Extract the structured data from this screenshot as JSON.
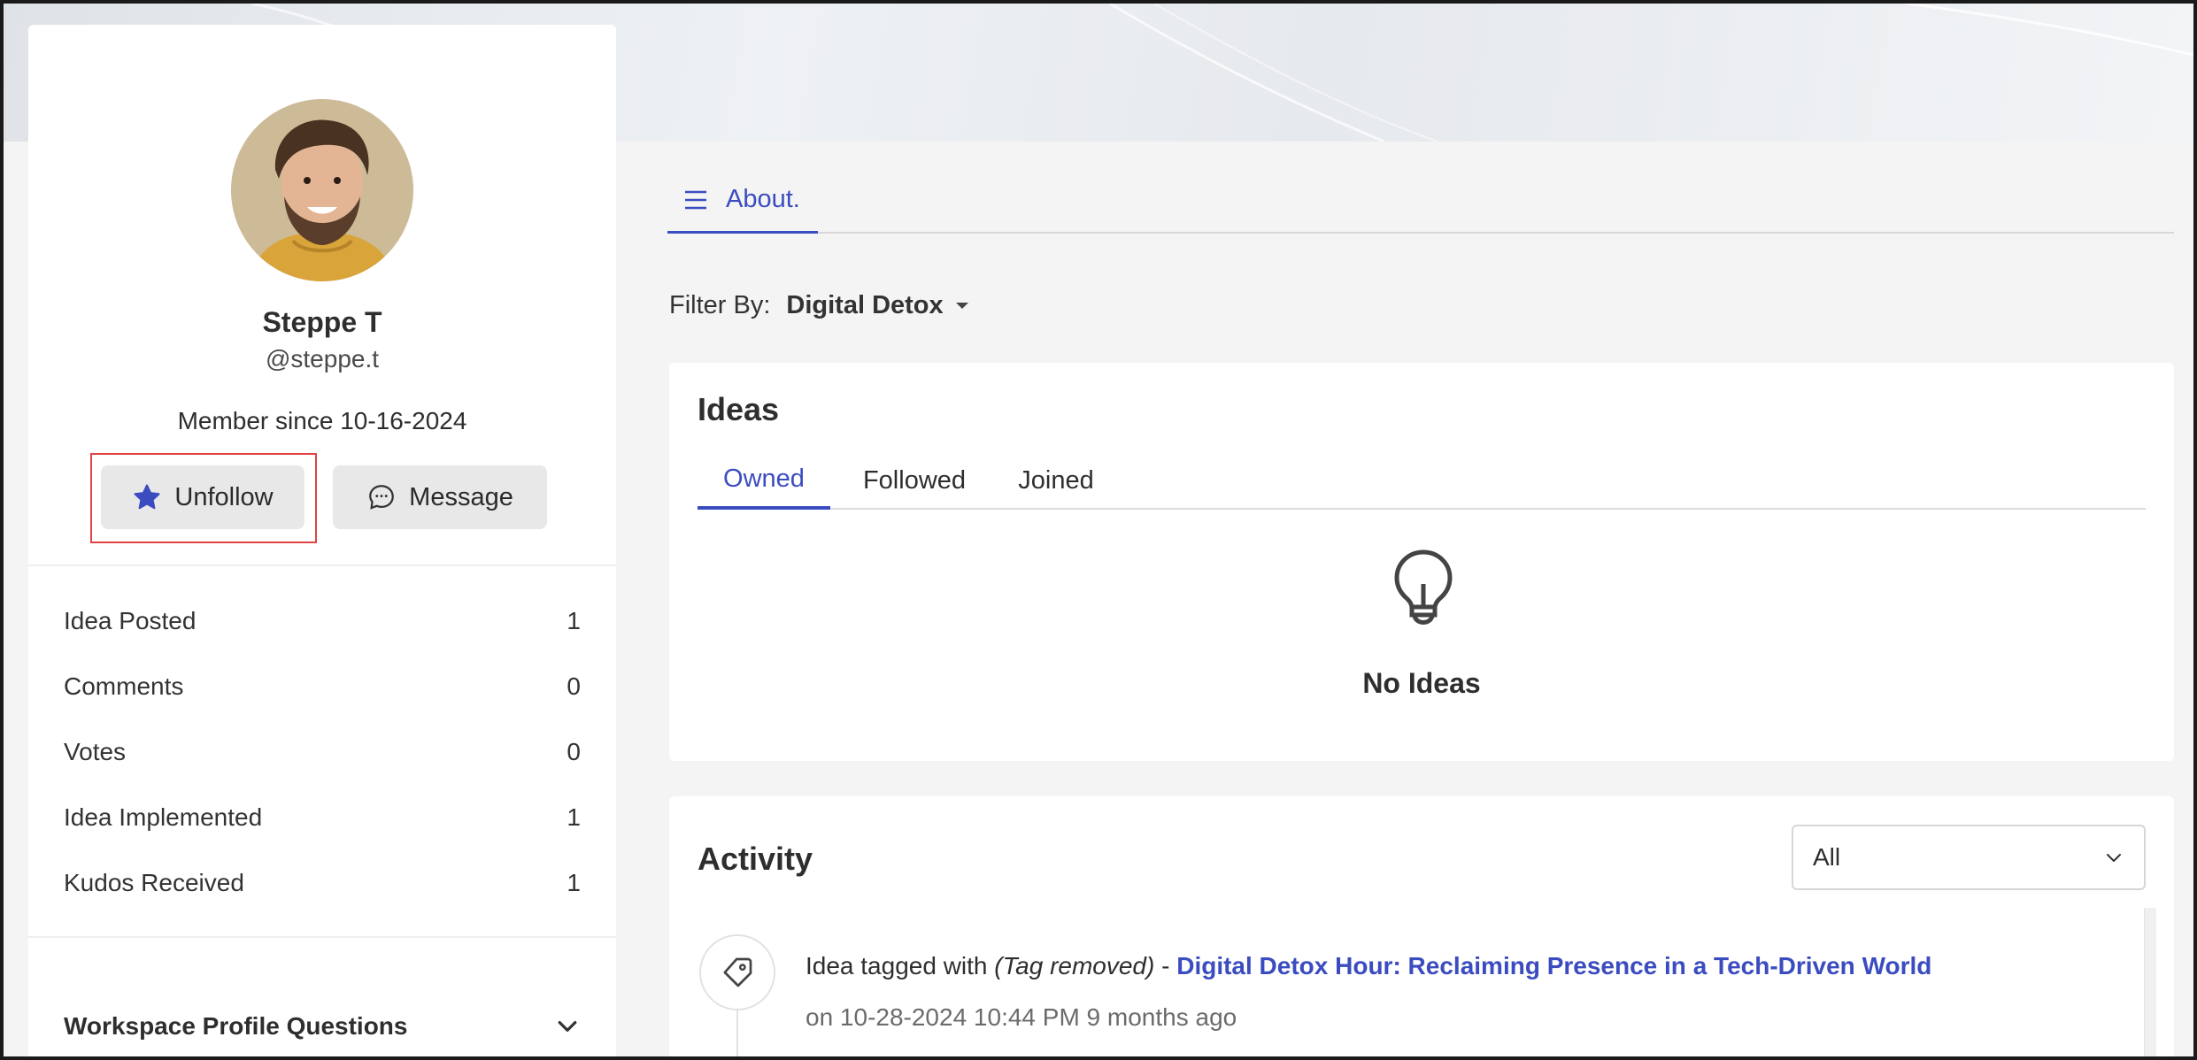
{
  "profile": {
    "name": "Steppe T",
    "handle": "@steppe.t",
    "member_since_label": "Member since",
    "member_since_date": "10-16-2024",
    "unfollow_label": "Unfollow",
    "message_label": "Message",
    "stats": [
      {
        "label": "Idea Posted",
        "value": "1"
      },
      {
        "label": "Comments",
        "value": "0"
      },
      {
        "label": "Votes",
        "value": "0"
      },
      {
        "label": "Idea Implemented",
        "value": "1"
      },
      {
        "label": "Kudos Received",
        "value": "1"
      }
    ],
    "workspace_questions_label": "Workspace Profile Questions"
  },
  "main": {
    "about_tab_label": "About.",
    "filter_label": "Filter By:",
    "filter_value": "Digital Detox",
    "ideas": {
      "title": "Ideas",
      "tabs": [
        "Owned",
        "Followed",
        "Joined"
      ],
      "active_tab": "Owned",
      "empty_label": "No Ideas"
    },
    "activity": {
      "title": "Activity",
      "filter_value": "All",
      "items": [
        {
          "prefix": "Idea tagged with",
          "tag": "(Tag removed)",
          "separator": "-",
          "link": "Digital Detox Hour: Reclaiming Presence in a Tech-Driven World",
          "date": "on 10-28-2024 10:44 PM 9 months ago"
        }
      ]
    }
  },
  "colors": {
    "accent": "#3b4cc0",
    "focus_outline": "#e04343",
    "button_bg": "#e8e8e8"
  }
}
